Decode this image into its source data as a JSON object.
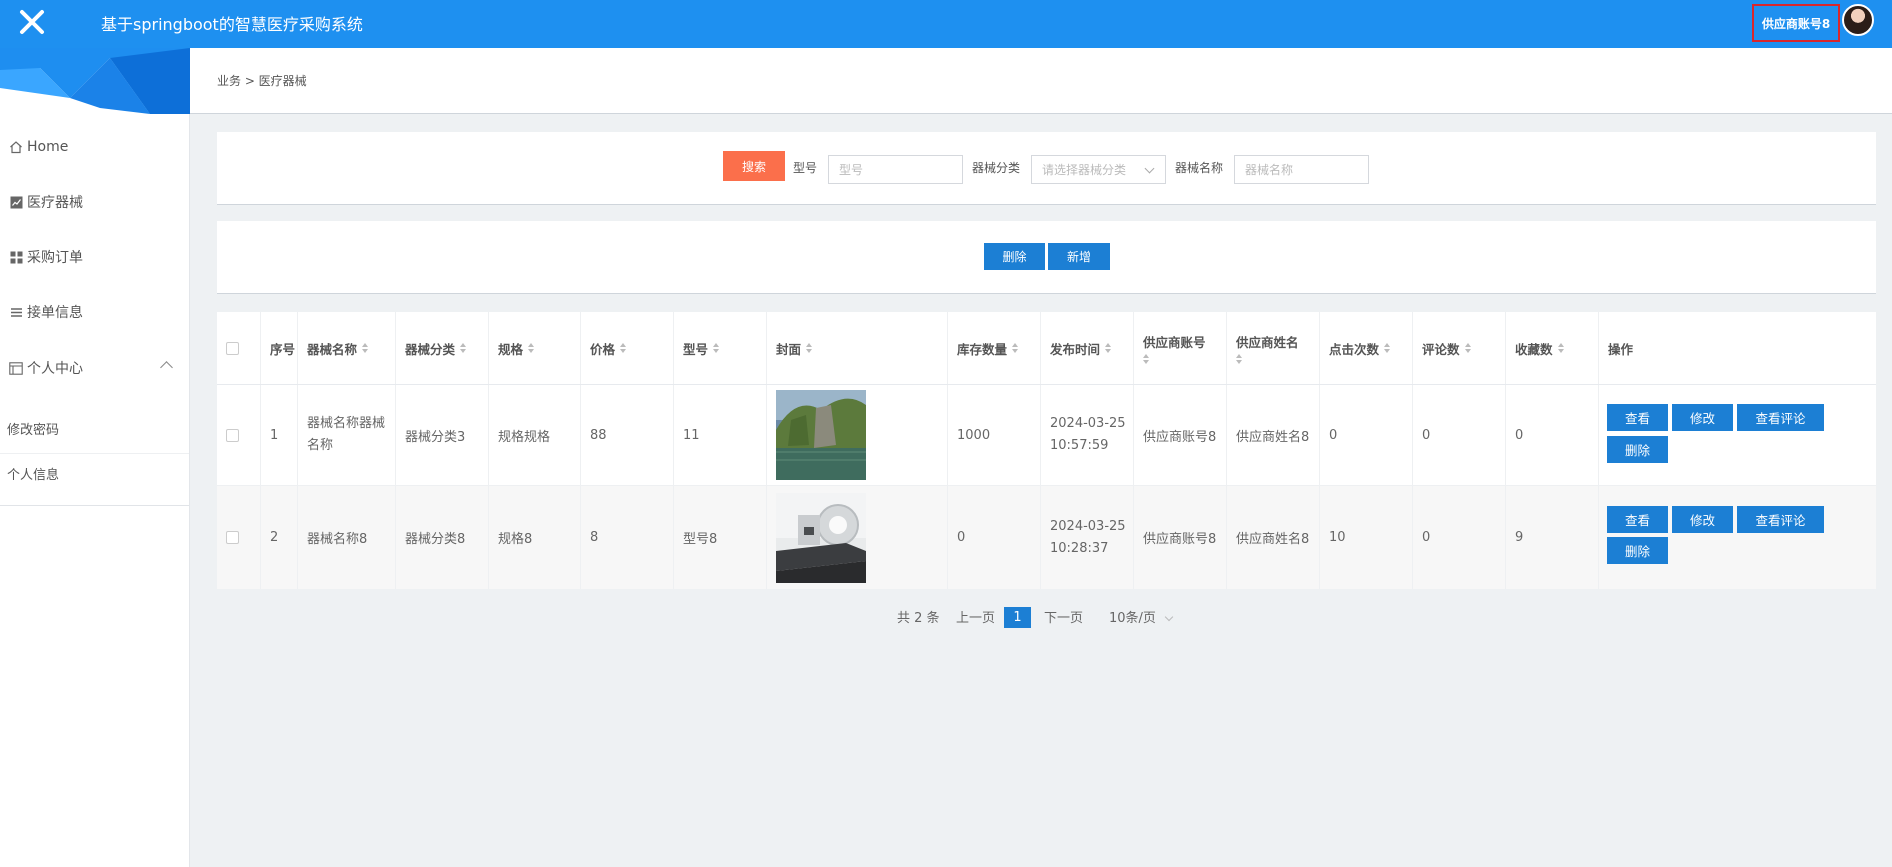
{
  "header": {
    "title": "基于springboot的智慧医疗采购系统",
    "user": "供应商账号8",
    "accent": "#1e90f0"
  },
  "sidebar": {
    "items": [
      {
        "label": "Home",
        "icon": "home-icon"
      },
      {
        "label": "医疗器械",
        "icon": "chart-icon"
      },
      {
        "label": "采购订单",
        "icon": "grid-icon"
      },
      {
        "label": "接单信息",
        "icon": "list-icon"
      },
      {
        "label": "个人中心",
        "icon": "profile-icon"
      }
    ],
    "subitems": [
      "修改密码",
      "个人信息"
    ]
  },
  "breadcrumb": "业务 > 医疗器械",
  "search": {
    "button": "搜索",
    "model_label": "型号",
    "model_placeholder": "型号",
    "category_label": "器械分类",
    "category_placeholder": "请选择器械分类",
    "name_label": "器械名称",
    "name_placeholder": "器械名称",
    "button_color": "#fb6f4b"
  },
  "actions": {
    "delete": "删除",
    "add": "新增"
  },
  "table": {
    "columns": [
      "序号",
      "器械名称",
      "器械分类",
      "规格",
      "价格",
      "型号",
      "封面",
      "库存数量",
      "发布时间",
      "供应商账号",
      "供应商姓名",
      "点击次数",
      "评论数",
      "收藏数",
      "操作"
    ],
    "rows": [
      {
        "index": "1",
        "name": "器械名称器械名称",
        "category": "器械分类3",
        "spec": "规格规格",
        "price": "88",
        "model": "11",
        "stock": "1000",
        "date": "2024-03-25",
        "time": "10:57:59",
        "supplier_account": "供应商账号8",
        "supplier_name": "供应商姓名8",
        "clicks": "0",
        "comments": "0",
        "favorites": "0"
      },
      {
        "index": "2",
        "name": "器械名称8",
        "category": "器械分类8",
        "spec": "规格8",
        "price": "8",
        "model": "型号8",
        "stock": "0",
        "date": "2024-03-25",
        "time": "10:28:37",
        "supplier_account": "供应商账号8",
        "supplier_name": "供应商姓名8",
        "clicks": "10",
        "comments": "0",
        "favorites": "9"
      }
    ],
    "row_actions": {
      "view": "查看",
      "edit": "修改",
      "comments": "查看评论",
      "delete": "删除"
    },
    "button_color": "#1c7fd4"
  },
  "pagination": {
    "total": "共 2 条",
    "prev": "上一页",
    "current": "1",
    "next": "下一页",
    "page_size": "10条/页"
  }
}
